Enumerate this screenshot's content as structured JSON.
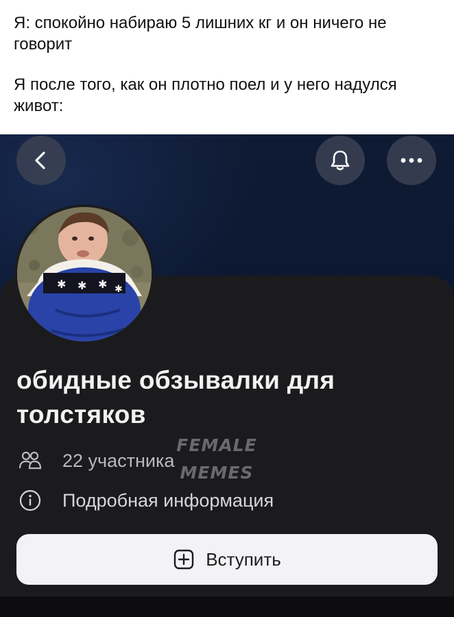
{
  "caption": {
    "line1": "Я: спокойно набираю 5 лишних кг и он ничего не говорит",
    "line2": "Я после того, как он плотно поел и у него надулся живот:"
  },
  "topbar": {
    "back_icon": "chevron-left-icon",
    "bell_icon": "bell-icon",
    "more_icon": "more-dots-icon"
  },
  "group": {
    "title": "обидные обзывалки для толстяков",
    "members_icon": "people-icon",
    "members_text": "22 участника",
    "info_icon": "info-icon",
    "info_text": "Подробная информация"
  },
  "join": {
    "icon": "plus-square-icon",
    "label": "Вступить"
  },
  "watermark": {
    "line1": "FEMALE",
    "line2": "MEMES"
  },
  "colors": {
    "background_top": "#0f1a33",
    "card": "#1b1b1e",
    "join_button": "#f3f3f5",
    "text_primary": "#f2f2f2",
    "text_secondary": "#b9b9bf"
  }
}
